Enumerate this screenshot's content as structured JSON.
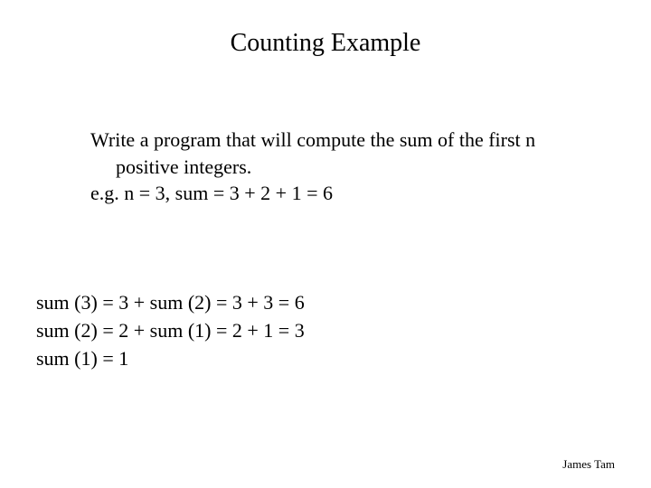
{
  "title": "Counting Example",
  "body": {
    "line1": "Write a program that will compute the sum of the first n",
    "line2": "positive integers.",
    "line3": "e.g. n = 3, sum = 3 + 2 + 1 = 6"
  },
  "work": {
    "line1": "sum (3) = 3 + sum (2)  = 3 + 3 = 6",
    "line2": "sum (2) = 2 + sum (1)  = 2 + 1 = 3",
    "line3": "sum (1) = 1"
  },
  "footer": "James Tam"
}
